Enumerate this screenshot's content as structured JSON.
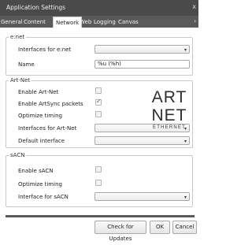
{
  "window": {
    "title": "Application Settings",
    "close_label": "x"
  },
  "tabs": [
    {
      "label": "General"
    },
    {
      "label": "Content"
    },
    {
      "label": "Network",
      "active": true
    },
    {
      "label": "Web"
    },
    {
      "label": "Logging"
    },
    {
      "label": "Canvas"
    }
  ],
  "enet": {
    "title": "e:net",
    "interfaces_label": "Interfaces for e:net",
    "interfaces_value": "",
    "name_label": "Name",
    "name_value": "%u (%h)"
  },
  "artnet": {
    "title": "Art-Net",
    "enable_label": "Enable Art-Net",
    "enable_checked": false,
    "artsync_label": "Enable ArtSync packets",
    "artsync_checked": true,
    "optimize_label": "Optimize timing",
    "optimize_checked": false,
    "interfaces_label": "Interfaces for Art-Net",
    "interfaces_value": "",
    "default_interface_label": "Default interface",
    "default_interface_value": "",
    "logo_line1": "ART",
    "logo_line2": "NET",
    "logo_line3": "ETHERNET"
  },
  "sacn": {
    "title": "sACN",
    "enable_label": "Enable sACN",
    "enable_checked": false,
    "optimize_label": "Optimize timing",
    "optimize_checked": false,
    "interface_label": "Interface for sACN",
    "interface_value": ""
  },
  "buttons": {
    "check_updates": "Check for Updates",
    "ok": "OK",
    "cancel": "Cancel"
  },
  "icons": {
    "dropdown": "chevron-down-icon",
    "check": "checkmark-icon",
    "tab_scroll": "chevron-right-icon"
  }
}
